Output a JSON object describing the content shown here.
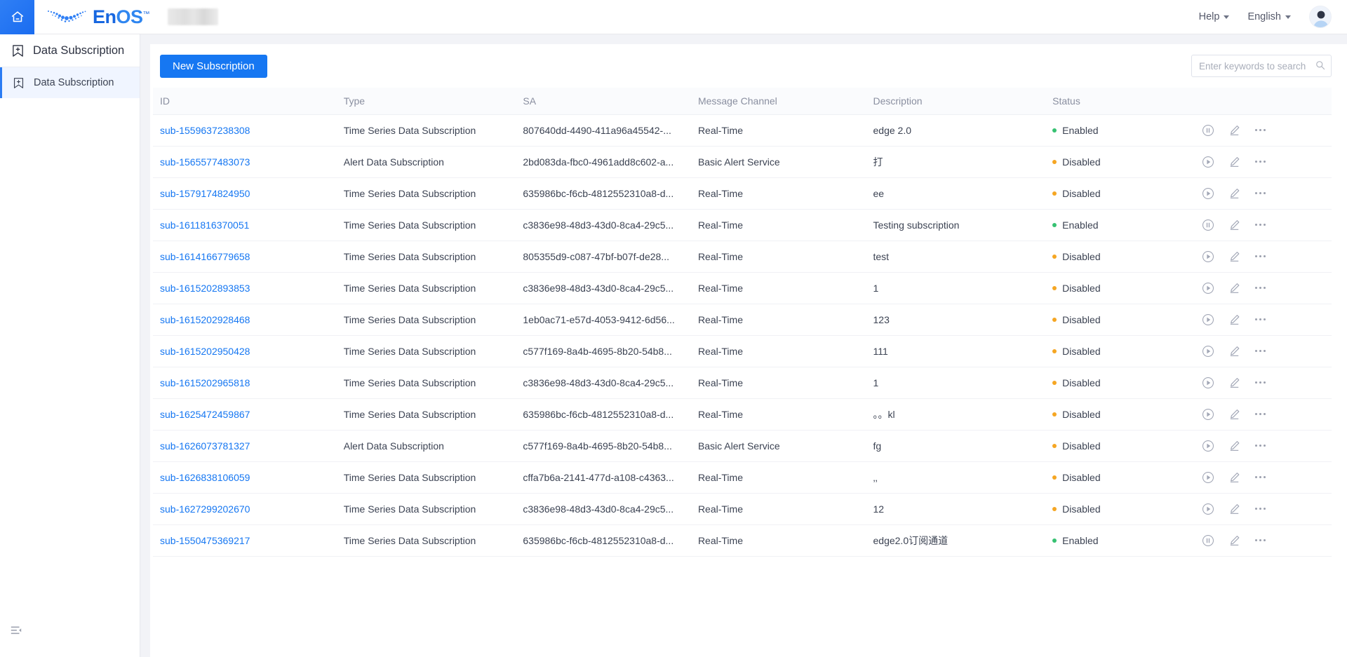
{
  "app": {
    "home_icon": "home-icon",
    "brand_name_en": "En",
    "brand_name_os": "OS",
    "brand_tm": "™",
    "accent_color": "#1677f2",
    "enabled_color": "#37c172",
    "disabled_color": "#f5a623"
  },
  "topbar": {
    "help_label": "Help",
    "language_label": "English",
    "avatar_icon": "user-avatar-icon"
  },
  "sidebar": {
    "header": {
      "label": "Data Subscription",
      "icon": "bookmark-plus-icon"
    },
    "items": [
      {
        "label": "Data Subscription",
        "icon": "bookmark-plus-icon",
        "active": true
      }
    ],
    "collapse_icon": "menu-fold-icon"
  },
  "toolbar": {
    "new_subscription_label": "New Subscription",
    "search_placeholder": "Enter keywords to search",
    "search_value": "",
    "search_icon": "search-icon"
  },
  "table": {
    "columns": [
      "ID",
      "Type",
      "SA",
      "Message Channel",
      "Description",
      "Status",
      ""
    ],
    "rows": [
      {
        "id": "sub-1559637238308",
        "type": "Time Series Data Subscription",
        "sa": "807640dd-4490-411a96a45542-...",
        "channel": "Real-Time",
        "description": "edge 2.0",
        "status": "Enabled",
        "toggle_icon": "pause-circle-icon",
        "edit_icon": "edit-pencil-icon",
        "more_icon": "more-horizontal-icon"
      },
      {
        "id": "sub-1565577483073",
        "type": "Alert Data Subscription",
        "sa": "2bd083da-fbc0-4961add8c602-a...",
        "channel": "Basic Alert Service",
        "description": "打",
        "status": "Disabled",
        "toggle_icon": "play-circle-icon",
        "edit_icon": "edit-pencil-icon",
        "more_icon": "more-horizontal-icon"
      },
      {
        "id": "sub-1579174824950",
        "type": "Time Series Data Subscription",
        "sa": "635986bc-f6cb-4812552310a8-d...",
        "channel": "Real-Time",
        "description": "ee",
        "status": "Disabled",
        "toggle_icon": "play-circle-icon",
        "edit_icon": "edit-pencil-icon",
        "more_icon": "more-horizontal-icon"
      },
      {
        "id": "sub-1611816370051",
        "type": "Time Series Data Subscription",
        "sa": "c3836e98-48d3-43d0-8ca4-29c5...",
        "channel": "Real-Time",
        "description": "Testing subscription",
        "status": "Enabled",
        "toggle_icon": "pause-circle-icon",
        "edit_icon": "edit-pencil-icon",
        "more_icon": "more-horizontal-icon"
      },
      {
        "id": "sub-1614166779658",
        "type": "Time Series Data Subscription",
        "sa": "805355d9-c087-47bf-b07f-de28...",
        "channel": "Real-Time",
        "description": "test",
        "status": "Disabled",
        "toggle_icon": "play-circle-icon",
        "edit_icon": "edit-pencil-icon",
        "more_icon": "more-horizontal-icon"
      },
      {
        "id": "sub-1615202893853",
        "type": "Time Series Data Subscription",
        "sa": "c3836e98-48d3-43d0-8ca4-29c5...",
        "channel": "Real-Time",
        "description": "1",
        "status": "Disabled",
        "toggle_icon": "play-circle-icon",
        "edit_icon": "edit-pencil-icon",
        "more_icon": "more-horizontal-icon"
      },
      {
        "id": "sub-1615202928468",
        "type": "Time Series Data Subscription",
        "sa": "1eb0ac71-e57d-4053-9412-6d56...",
        "channel": "Real-Time",
        "description": "123",
        "status": "Disabled",
        "toggle_icon": "play-circle-icon",
        "edit_icon": "edit-pencil-icon",
        "more_icon": "more-horizontal-icon"
      },
      {
        "id": "sub-1615202950428",
        "type": "Time Series Data Subscription",
        "sa": "c577f169-8a4b-4695-8b20-54b8...",
        "channel": "Real-Time",
        "description": "111",
        "status": "Disabled",
        "toggle_icon": "play-circle-icon",
        "edit_icon": "edit-pencil-icon",
        "more_icon": "more-horizontal-icon"
      },
      {
        "id": "sub-1615202965818",
        "type": "Time Series Data Subscription",
        "sa": "c3836e98-48d3-43d0-8ca4-29c5...",
        "channel": "Real-Time",
        "description": "1",
        "status": "Disabled",
        "toggle_icon": "play-circle-icon",
        "edit_icon": "edit-pencil-icon",
        "more_icon": "more-horizontal-icon"
      },
      {
        "id": "sub-1625472459867",
        "type": "Time Series Data Subscription",
        "sa": "635986bc-f6cb-4812552310a8-d...",
        "channel": "Real-Time",
        "description": "。。kl",
        "status": "Disabled",
        "toggle_icon": "play-circle-icon",
        "edit_icon": "edit-pencil-icon",
        "more_icon": "more-horizontal-icon"
      },
      {
        "id": "sub-1626073781327",
        "type": "Alert Data Subscription",
        "sa": "c577f169-8a4b-4695-8b20-54b8...",
        "channel": "Basic Alert Service",
        "description": "fg",
        "status": "Disabled",
        "toggle_icon": "play-circle-icon",
        "edit_icon": "edit-pencil-icon",
        "more_icon": "more-horizontal-icon"
      },
      {
        "id": "sub-1626838106059",
        "type": "Time Series Data Subscription",
        "sa": "cffa7b6a-2141-477d-a108-c4363...",
        "channel": "Real-Time",
        "description": "‚‚",
        "status": "Disabled",
        "toggle_icon": "play-circle-icon",
        "edit_icon": "edit-pencil-icon",
        "more_icon": "more-horizontal-icon"
      },
      {
        "id": "sub-1627299202670",
        "type": "Time Series Data Subscription",
        "sa": "c3836e98-48d3-43d0-8ca4-29c5...",
        "channel": "Real-Time",
        "description": "12",
        "status": "Disabled",
        "toggle_icon": "play-circle-icon",
        "edit_icon": "edit-pencil-icon",
        "more_icon": "more-horizontal-icon"
      },
      {
        "id": "sub-1550475369217",
        "type": "Time Series Data Subscription",
        "sa": "635986bc-f6cb-4812552310a8-d...",
        "channel": "Real-Time",
        "description": "edge2.0订阅通道",
        "status": "Enabled",
        "toggle_icon": "pause-circle-icon",
        "edit_icon": "edit-pencil-icon",
        "more_icon": "more-horizontal-icon"
      }
    ]
  }
}
